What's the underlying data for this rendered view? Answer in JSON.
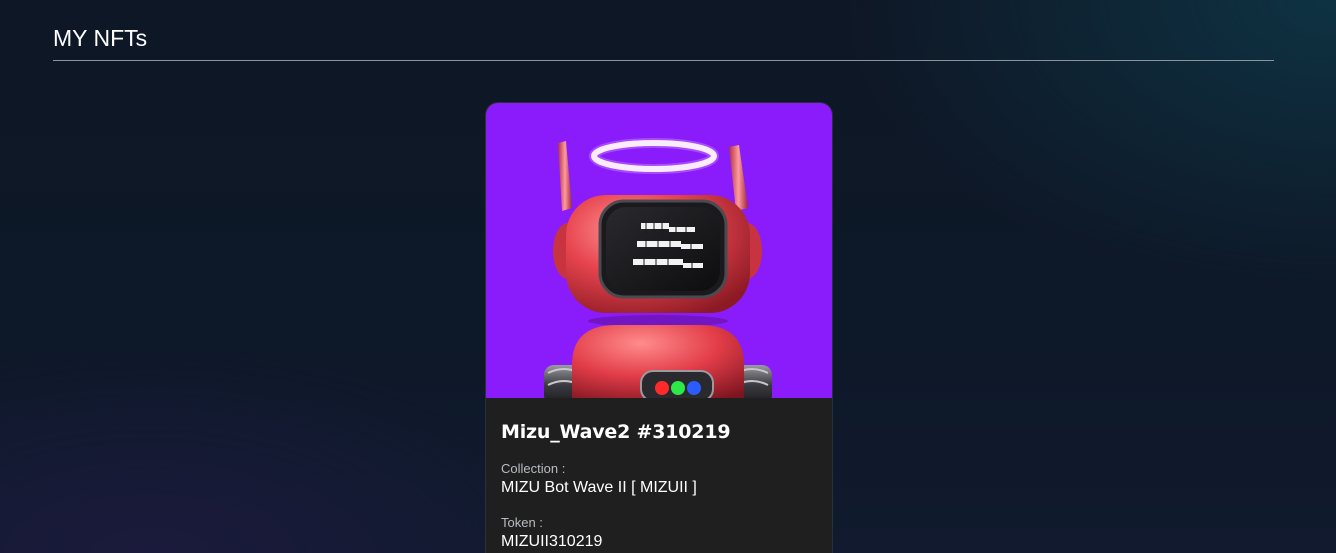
{
  "header": {
    "title": "MY NFTs"
  },
  "nfts": [
    {
      "name": "Mizu_Wave2 #310219",
      "image_icon": "robot-nft-artwork",
      "image_background": "#8a1cfc",
      "collection_label": "Collection :",
      "collection_value": "MIZU Bot Wave II [ MIZUII ]",
      "token_label": "Token :",
      "token_value": "MIZUII310219"
    }
  ]
}
